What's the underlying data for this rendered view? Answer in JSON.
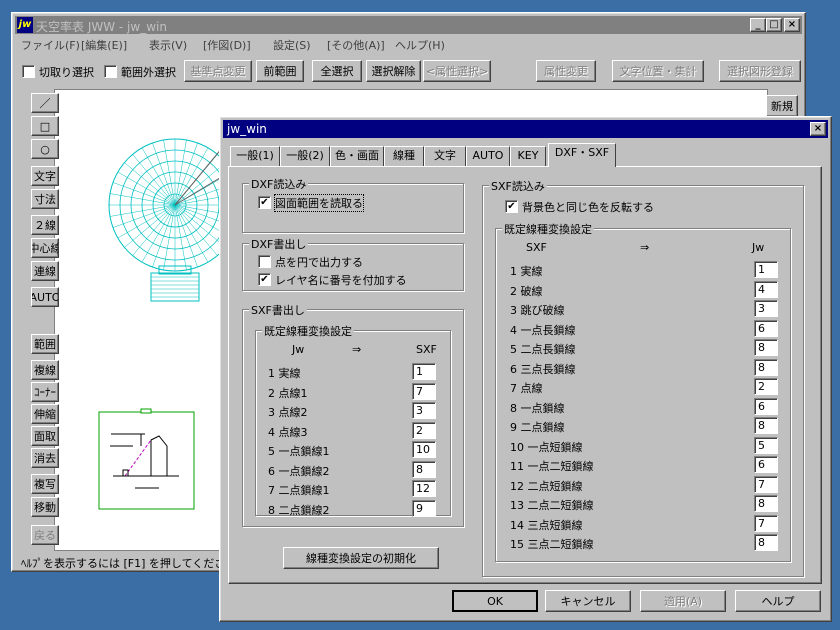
{
  "main": {
    "title": "天空率表 JWW - jw_win",
    "menu": [
      "ファイル(F)",
      "[編集(E)]",
      "表示(V)",
      "[作図(D)]",
      "設定(S)",
      "[その他(A)]",
      "ヘルプ(H)"
    ],
    "cut_select": "切取り選択",
    "out_select": "範囲外選択",
    "toolbar": [
      "基準点変更",
      "前範囲",
      "全選択",
      "選択解除",
      "<属性選択>",
      "属性変更",
      "文字位置・集計",
      "選択図形登録"
    ],
    "new_label": "新規",
    "side_tools": [
      "／",
      "□",
      "○",
      "文字",
      "寸法",
      "２線",
      "中心線",
      "連線",
      "AUTO",
      "範囲",
      "複線",
      "ｺｰﾅｰ",
      "伸縮",
      "面取",
      "消去",
      "複写",
      "移動",
      "戻る"
    ],
    "status": "ﾍﾙﾌﾟを表示するには [F1] を押してくださ"
  },
  "dialog": {
    "title": "jw_win",
    "tabs": [
      "一般(1)",
      "一般(2)",
      "色・画面",
      "線種",
      "文字",
      "AUTO",
      "KEY",
      "DXF・SXF"
    ],
    "dxf_read": {
      "label": "DXF読込み",
      "check": "図面範囲を読取る"
    },
    "dxf_write": {
      "label": "DXF書出し",
      "check1": "点を円で出力する",
      "check2": "レイヤ名に番号を付加する"
    },
    "sxf_write": {
      "label": "SXF書出し",
      "sub": "既定線種変換設定",
      "col_left": "Jw",
      "arrow": "⇒",
      "col_right": "SXF",
      "rows": [
        {
          "name": "1 実線",
          "value": "1"
        },
        {
          "name": "2 点線1",
          "value": "7"
        },
        {
          "name": "3 点線2",
          "value": "3"
        },
        {
          "name": "4 点線3",
          "value": "2"
        },
        {
          "name": "5 一点鎖線1",
          "value": "10"
        },
        {
          "name": "6 一点鎖線2",
          "value": "8"
        },
        {
          "name": "7 二点鎖線1",
          "value": "12"
        },
        {
          "name": "8 二点鎖線2",
          "value": "9"
        }
      ]
    },
    "sxf_read": {
      "label": "SXF読込み",
      "check": "背景色と同じ色を反転する",
      "sub": "既定線種変換設定",
      "col_left": "SXF",
      "arrow": "⇒",
      "col_right": "Jw",
      "rows": [
        {
          "name": "1 実線",
          "value": "1"
        },
        {
          "name": "2 破線",
          "value": "4"
        },
        {
          "name": "3 跳び破線",
          "value": "3"
        },
        {
          "name": "4 一点長鎖線",
          "value": "6"
        },
        {
          "name": "5 二点長鎖線",
          "value": "8"
        },
        {
          "name": "6 三点長鎖線",
          "value": "8"
        },
        {
          "name": "7 点線",
          "value": "2"
        },
        {
          "name": "8 一点鎖線",
          "value": "6"
        },
        {
          "name": "9 二点鎖線",
          "value": "8"
        },
        {
          "name": "10 一点短鎖線",
          "value": "5"
        },
        {
          "name": "11 一点二短鎖線",
          "value": "6"
        },
        {
          "name": "12 二点短鎖線",
          "value": "7"
        },
        {
          "name": "13 二点二短鎖線",
          "value": "8"
        },
        {
          "name": "14 三点短鎖線",
          "value": "7"
        },
        {
          "name": "15 三点二短鎖線",
          "value": "8"
        }
      ]
    },
    "reset_button": "線種変換設定の初期化",
    "ok": "OK",
    "cancel": "キャンセル",
    "apply": "適用(A)",
    "help": "ヘルプ"
  },
  "colors": {
    "desktop": "#3a6ea5",
    "titlebar_inactive": "#808080",
    "titlebar_active": "#000080",
    "drawing_cyan": "#00c0c0",
    "drawing_green": "#00a000"
  }
}
